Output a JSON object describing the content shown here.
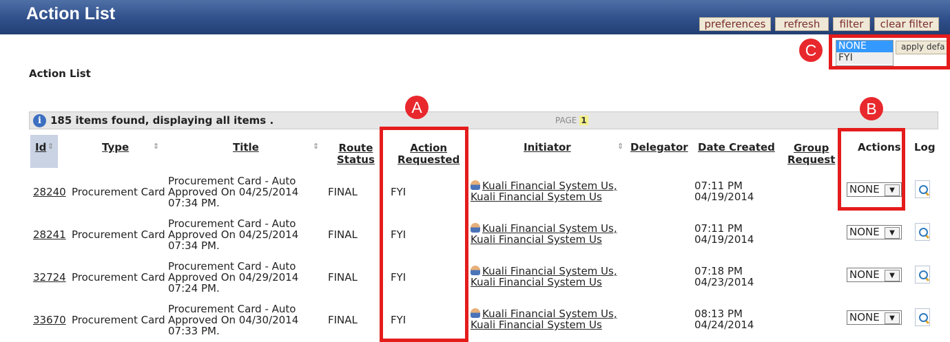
{
  "window": {
    "title": "Action List"
  },
  "toolbar": {
    "preferences": "preferences",
    "refresh": "refresh",
    "filter": "filter",
    "clear_filter": "clear filter"
  },
  "default_actions": {
    "options": [
      "NONE",
      "FYI"
    ],
    "selected": "NONE",
    "apply_label": "apply defa"
  },
  "annotations": {
    "a": "A",
    "b": "B",
    "c": "C"
  },
  "annotation_color": "#e41c1c",
  "page_heading": "Action List",
  "info": {
    "text": "185 items found, displaying all items .",
    "page_label": "PAGE",
    "page_number": "1",
    "icon": "info-icon"
  },
  "columns": {
    "id": "Id",
    "type": "Type",
    "title": "Title",
    "route_status_1": "Route",
    "route_status_2": "Status",
    "action_requested_1": "Action",
    "action_requested_2": "Requested",
    "initiator": "Initiator",
    "delegator": "Delegator",
    "date_created": "Date Created",
    "group_request_1": "Group",
    "group_request_2": "Request",
    "actions": "Actions",
    "log": "Log"
  },
  "rows": [
    {
      "id": "28240",
      "type": "Procurement Card",
      "title_1": "Procurement Card - Auto",
      "title_2": "Approved On 04/25/2014",
      "title_3": "07:34 PM.",
      "route_status": "FINAL",
      "action_requested": "FYI",
      "initiator_1": "Kuali Financial System Us,",
      "initiator_2": "Kuali Financial System Us",
      "time": "07:11 PM",
      "date": "04/19/2014",
      "action": "NONE"
    },
    {
      "id": "28241",
      "type": "Procurement Card",
      "title_1": "Procurement Card - Auto",
      "title_2": "Approved On 04/25/2014",
      "title_3": "07:34 PM.",
      "route_status": "FINAL",
      "action_requested": "FYI",
      "initiator_1": "Kuali Financial System Us,",
      "initiator_2": "Kuali Financial System Us",
      "time": "07:11 PM",
      "date": "04/19/2014",
      "action": "NONE"
    },
    {
      "id": "32724",
      "type": "Procurement Card",
      "title_1": "Procurement Card - Auto",
      "title_2": "Approved On 04/29/2014",
      "title_3": "07:24 PM.",
      "route_status": "FINAL",
      "action_requested": "FYI",
      "initiator_1": "Kuali Financial System Us,",
      "initiator_2": "Kuali Financial System Us",
      "time": "07:18 PM",
      "date": "04/23/2014",
      "action": "NONE"
    },
    {
      "id": "33670",
      "type": "Procurement Card",
      "title_1": "Procurement Card - Auto",
      "title_2": "Approved On 04/30/2014",
      "title_3": "07:33 PM.",
      "route_status": "FINAL",
      "action_requested": "FYI",
      "initiator_1": "Kuali Financial System Us,",
      "initiator_2": "Kuali Financial System Us",
      "time": "08:13 PM",
      "date": "04/24/2014",
      "action": "NONE"
    }
  ]
}
